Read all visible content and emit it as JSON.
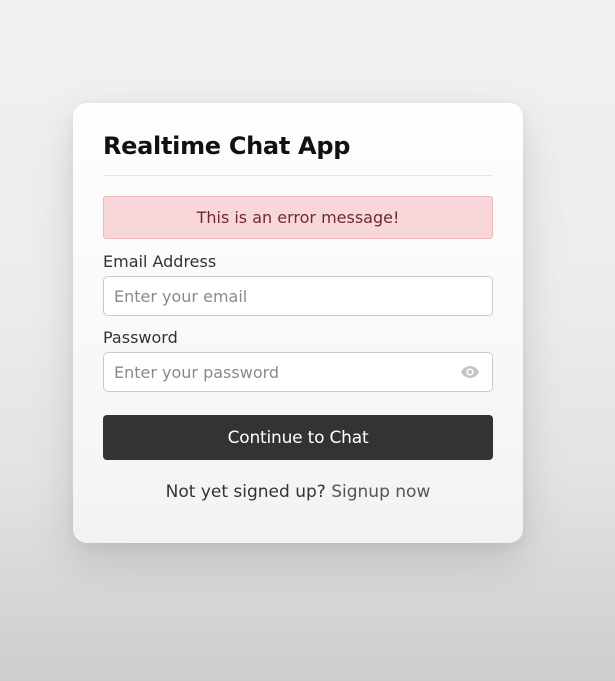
{
  "app": {
    "title": "Realtime Chat App"
  },
  "error": {
    "message": "This is an error message!"
  },
  "form": {
    "email": {
      "label": "Email Address",
      "placeholder": "Enter your email",
      "value": ""
    },
    "password": {
      "label": "Password",
      "placeholder": "Enter your password",
      "value": "",
      "toggle_icon": "eye-icon"
    },
    "submit_label": "Continue to Chat"
  },
  "signup": {
    "prompt": "Not yet signed up?",
    "link_label": "Signup now"
  },
  "colors": {
    "error_background": "#f8d7da",
    "error_text": "#6e2a31",
    "button_background": "#333333",
    "button_text": "#ffffff"
  }
}
